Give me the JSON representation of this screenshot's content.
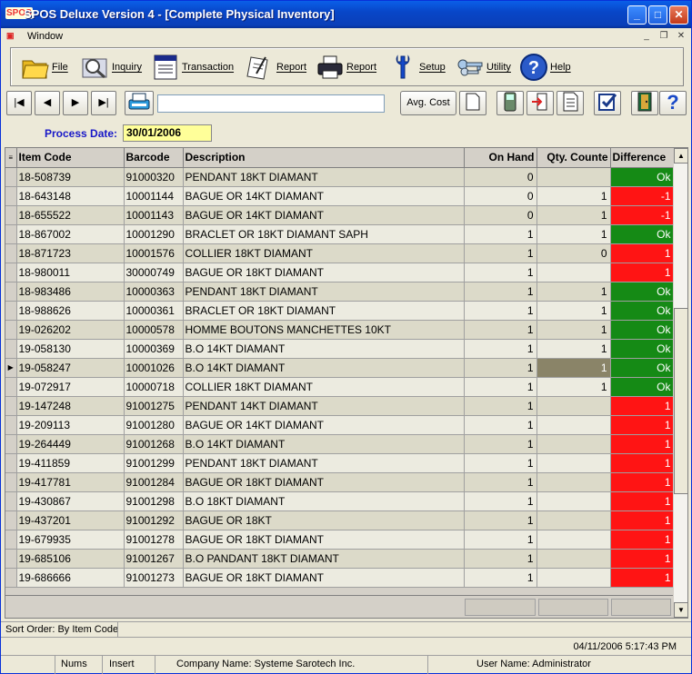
{
  "window": {
    "title": "SPOS Deluxe Version 4 - [Complete Physical Inventory]",
    "app_icon_text": "SPOS",
    "minimize_glyph": "_",
    "maximize_glyph": "□",
    "close_glyph": "✕"
  },
  "menubar": {
    "window_menu": "Window",
    "mdi_min": "_",
    "mdi_restore": "❐",
    "mdi_close": "✕"
  },
  "toolbar_main": [
    {
      "label": "File",
      "icon": "folder-icon"
    },
    {
      "label": "Inquiry",
      "icon": "magnifier-icon"
    },
    {
      "label": "Transaction",
      "icon": "invoice-icon"
    },
    {
      "label": "Report",
      "icon": "report-pen-icon"
    },
    {
      "label": "Report",
      "icon": "printer-icon"
    },
    {
      "label": "Setup",
      "icon": "wrench-icon"
    },
    {
      "label": "Utility",
      "icon": "keys-icon"
    },
    {
      "label": "Help",
      "icon": "help-icon"
    }
  ],
  "nav": {
    "first": "|◀",
    "prev": "◀",
    "next": "▶",
    "last": "▶|",
    "avg_cost": "Avg. Cost",
    "search_value": ""
  },
  "process_date": {
    "label": "Process Date:",
    "value": "30/01/2006"
  },
  "grid": {
    "columns": [
      "Item Code",
      "Barcode",
      "Description",
      "On Hand",
      "Qty. Counte",
      "Difference"
    ],
    "selected_row_index": 10,
    "rows": [
      {
        "item_code": "18-508739",
        "barcode": "91000320",
        "description": "PENDANT 18KT DIAMANT",
        "on_hand": "0",
        "qty_counted": "",
        "difference": "Ok",
        "status": "ok"
      },
      {
        "item_code": "18-643148",
        "barcode": "10001144",
        "description": "BAGUE OR 14KT DIAMANT",
        "on_hand": "0",
        "qty_counted": "1",
        "difference": "-1",
        "status": "bad"
      },
      {
        "item_code": "18-655522",
        "barcode": "10001143",
        "description": "BAGUE OR 14KT DIAMANT",
        "on_hand": "0",
        "qty_counted": "1",
        "difference": "-1",
        "status": "bad"
      },
      {
        "item_code": "18-867002",
        "barcode": "10001290",
        "description": "BRACLET OR 18KT DIAMANT SAPH",
        "on_hand": "1",
        "qty_counted": "1",
        "difference": "Ok",
        "status": "ok"
      },
      {
        "item_code": "18-871723",
        "barcode": "10001576",
        "description": "COLLIER 18KT DIAMANT",
        "on_hand": "1",
        "qty_counted": "0",
        "difference": "1",
        "status": "bad"
      },
      {
        "item_code": "18-980011",
        "barcode": "30000749",
        "description": "BAGUE OR 18KT DIAMANT",
        "on_hand": "1",
        "qty_counted": "",
        "difference": "1",
        "status": "bad"
      },
      {
        "item_code": "18-983486",
        "barcode": "10000363",
        "description": "PENDANT 18KT DIAMANT",
        "on_hand": "1",
        "qty_counted": "1",
        "difference": "Ok",
        "status": "ok"
      },
      {
        "item_code": "18-988626",
        "barcode": "10000361",
        "description": "BRACLET OR 18KT DIAMANT",
        "on_hand": "1",
        "qty_counted": "1",
        "difference": "Ok",
        "status": "ok"
      },
      {
        "item_code": "19-026202",
        "barcode": "10000578",
        "description": "HOMME BOUTONS MANCHETTES 10KT",
        "on_hand": "1",
        "qty_counted": "1",
        "difference": "Ok",
        "status": "ok"
      },
      {
        "item_code": "19-058130",
        "barcode": "10000369",
        "description": "B.O 14KT DIAMANT",
        "on_hand": "1",
        "qty_counted": "1",
        "difference": "Ok",
        "status": "ok"
      },
      {
        "item_code": "19-058247",
        "barcode": "10001026",
        "description": "B.O 14KT DIAMANT",
        "on_hand": "1",
        "qty_counted": "1",
        "difference": "Ok",
        "status": "ok"
      },
      {
        "item_code": "19-072917",
        "barcode": "10000718",
        "description": "COLLIER 18KT DIAMANT",
        "on_hand": "1",
        "qty_counted": "1",
        "difference": "Ok",
        "status": "ok"
      },
      {
        "item_code": "19-147248",
        "barcode": "91001275",
        "description": "PENDANT 14KT DIAMANT",
        "on_hand": "1",
        "qty_counted": "",
        "difference": "1",
        "status": "bad"
      },
      {
        "item_code": "19-209113",
        "barcode": "91001280",
        "description": "BAGUE OR 14KT DIAMANT",
        "on_hand": "1",
        "qty_counted": "",
        "difference": "1",
        "status": "bad"
      },
      {
        "item_code": "19-264449",
        "barcode": "91001268",
        "description": "B.O 14KT DIAMANT",
        "on_hand": "1",
        "qty_counted": "",
        "difference": "1",
        "status": "bad"
      },
      {
        "item_code": "19-411859",
        "barcode": "91001299",
        "description": "PENDANT 18KT DIAMANT",
        "on_hand": "1",
        "qty_counted": "",
        "difference": "1",
        "status": "bad"
      },
      {
        "item_code": "19-417781",
        "barcode": "91001284",
        "description": "BAGUE OR 18KT DIAMANT",
        "on_hand": "1",
        "qty_counted": "",
        "difference": "1",
        "status": "bad"
      },
      {
        "item_code": "19-430867",
        "barcode": "91001298",
        "description": "B.O 18KT DIAMANT",
        "on_hand": "1",
        "qty_counted": "",
        "difference": "1",
        "status": "bad"
      },
      {
        "item_code": "19-437201",
        "barcode": "91001292",
        "description": "BAGUE OR 18KT",
        "on_hand": "1",
        "qty_counted": "",
        "difference": "1",
        "status": "bad"
      },
      {
        "item_code": "19-679935",
        "barcode": "91001278",
        "description": "BAGUE OR 18KT DIAMANT",
        "on_hand": "1",
        "qty_counted": "",
        "difference": "1",
        "status": "bad"
      },
      {
        "item_code": "19-685106",
        "barcode": "91001267",
        "description": "B.O PANDANT 18KT DIAMANT",
        "on_hand": "1",
        "qty_counted": "",
        "difference": "1",
        "status": "bad"
      },
      {
        "item_code": "19-686666",
        "barcode": "91001273",
        "description": "BAGUE OR 18KT DIAMANT",
        "on_hand": "1",
        "qty_counted": "",
        "difference": "1",
        "status": "bad"
      }
    ]
  },
  "status": {
    "sort_order": "Sort Order: By Item Code",
    "datetime": "04/11/2006  5:17:43 PM",
    "nums": "Nums",
    "insert": "Insert",
    "company": "Company Name: Systeme Sarotech Inc.",
    "user": "User Name: Administrator"
  },
  "colors": {
    "ok": "#158a15",
    "bad": "#ff1414",
    "title_bar": "#0a4fd0",
    "process_date_label": "#1818c8",
    "process_date_bg": "#ffff99"
  }
}
